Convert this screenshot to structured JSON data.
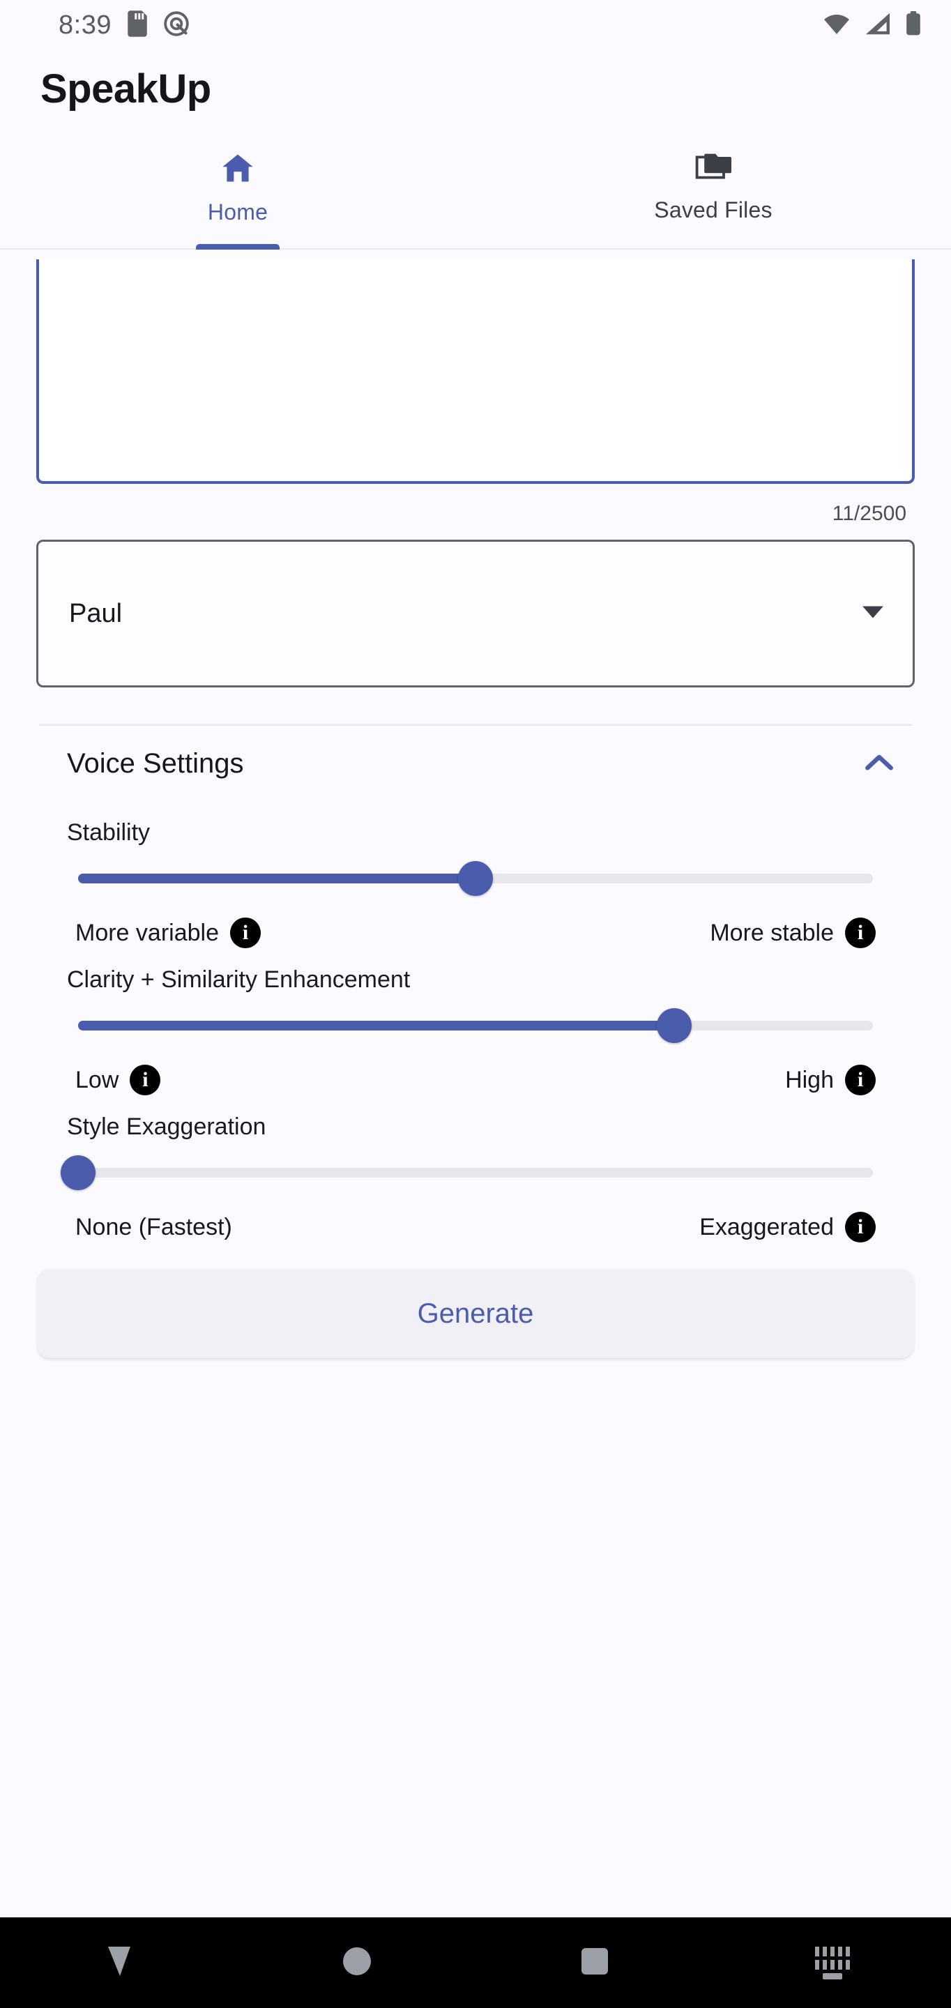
{
  "status_bar": {
    "time": "8:39",
    "left_icons": [
      "sd-card-icon",
      "android-q-icon"
    ],
    "right_icons": [
      "wifi-icon",
      "cellular-signal-icon",
      "battery-icon"
    ]
  },
  "app": {
    "title": "SpeakUp",
    "accent_color": "#4b5cad",
    "background_color": "#fbfaff"
  },
  "tabs": [
    {
      "label": "Home",
      "icon": "home-icon",
      "active": true
    },
    {
      "label": "Saved Files",
      "icon": "folder-copy-icon",
      "active": false
    }
  ],
  "text_input": {
    "value": "",
    "placeholder": "",
    "char_counter": "11/2500"
  },
  "voice_select": {
    "value": "Paul",
    "icon": "chevron-down-icon"
  },
  "voice_settings": {
    "title": "Voice Settings",
    "expanded": true,
    "collapse_icon": "chevron-up-icon",
    "sliders": [
      {
        "label": "Stability",
        "value": 50,
        "min": 0,
        "max": 100,
        "left_label": "More variable",
        "left_info": true,
        "right_label": "More stable",
        "right_info": true
      },
      {
        "label": "Clarity + Similarity Enhancement",
        "value": 75,
        "min": 0,
        "max": 100,
        "left_label": "Low",
        "left_info": true,
        "right_label": "High",
        "right_info": true
      },
      {
        "label": "Style Exaggeration",
        "value": 0,
        "min": 0,
        "max": 100,
        "left_label": "None (Fastest)",
        "left_info": false,
        "right_label": "Exaggerated",
        "right_info": true
      }
    ]
  },
  "generate_button": {
    "label": "Generate"
  },
  "nav_bar": {
    "items": [
      {
        "icon": "back-down-icon"
      },
      {
        "icon": "home-circle-icon"
      },
      {
        "icon": "recents-square-icon"
      },
      {
        "icon": "keyboard-switch-icon"
      }
    ]
  }
}
